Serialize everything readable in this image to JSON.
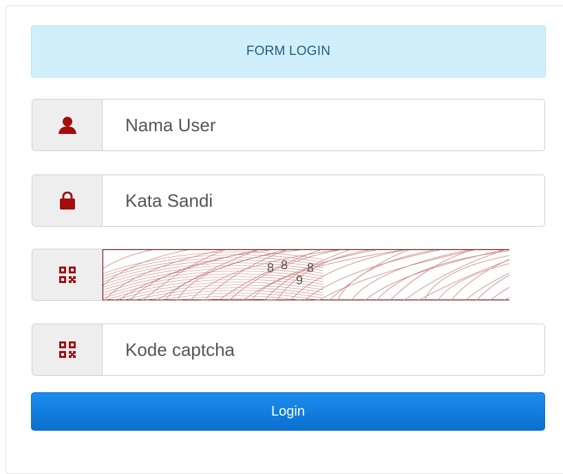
{
  "header": {
    "title": "FORM LOGIN"
  },
  "username": {
    "placeholder": "Nama User",
    "icon": "user-icon"
  },
  "password": {
    "placeholder": "Kata Sandi",
    "icon": "lock-icon"
  },
  "captcha": {
    "code": "8889",
    "icon": "qrcode-icon"
  },
  "captcha_input": {
    "placeholder": "Kode captcha",
    "icon": "qrcode-icon"
  },
  "login": {
    "label": "Login"
  },
  "colors": {
    "icon": "#a30d0d",
    "header_bg": "#d1effa",
    "header_text": "#1d5d86",
    "button": "#1c8df0"
  }
}
